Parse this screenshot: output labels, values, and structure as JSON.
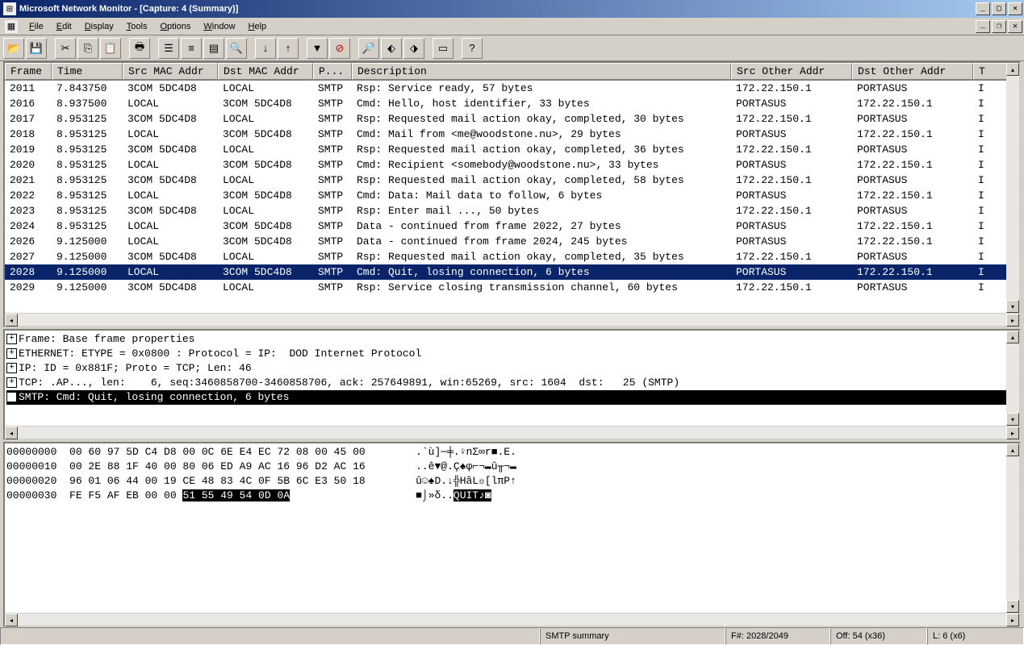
{
  "window": {
    "title": "Microsoft Network Monitor - [Capture: 4 (Summary)]"
  },
  "menu": {
    "file": "File",
    "edit": "Edit",
    "display": "Display",
    "tools": "Tools",
    "options": "Options",
    "window": "Window",
    "help": "Help"
  },
  "toolbar": {
    "open": "open",
    "save": "save",
    "cut": "cut",
    "copy": "copy",
    "paste": "paste",
    "print": "print",
    "view1": "summary",
    "view2": "detail",
    "view3": "hex",
    "zoom": "zoom",
    "down": "down",
    "up": "up",
    "filter": "filter",
    "nofilter": "nofilter",
    "find": "find",
    "prev": "prev-frame",
    "next": "next-frame",
    "pane": "pane",
    "help": "help"
  },
  "columns": {
    "frame": "Frame",
    "time": "Time",
    "srcmac": "Src MAC Addr",
    "dstmac": "Dst MAC Addr",
    "proto": "P...",
    "desc": "Description",
    "srcother": "Src Other Addr",
    "dstother": "Dst Other Addr",
    "t": "T"
  },
  "rows": [
    {
      "frame": "2011",
      "time": "7.843750",
      "srcmac": "3COM  5DC4D8",
      "dstmac": "LOCAL",
      "proto": "SMTP",
      "desc": "Rsp: Service ready, 57 bytes",
      "srcother": "172.22.150.1",
      "dstother": "PORTASUS",
      "t": "I"
    },
    {
      "frame": "2016",
      "time": "8.937500",
      "srcmac": "LOCAL",
      "dstmac": "3COM  5DC4D8",
      "proto": "SMTP",
      "desc": "Cmd: Hello, host identifier, 33 bytes",
      "srcother": "PORTASUS",
      "dstother": "172.22.150.1",
      "t": "I"
    },
    {
      "frame": "2017",
      "time": "8.953125",
      "srcmac": "3COM  5DC4D8",
      "dstmac": "LOCAL",
      "proto": "SMTP",
      "desc": "Rsp: Requested mail action okay, completed, 30 bytes",
      "srcother": "172.22.150.1",
      "dstother": "PORTASUS",
      "t": "I"
    },
    {
      "frame": "2018",
      "time": "8.953125",
      "srcmac": "LOCAL",
      "dstmac": "3COM  5DC4D8",
      "proto": "SMTP",
      "desc": "Cmd: Mail from <me@woodstone.nu>, 29 bytes",
      "srcother": "PORTASUS",
      "dstother": "172.22.150.1",
      "t": "I"
    },
    {
      "frame": "2019",
      "time": "8.953125",
      "srcmac": "3COM  5DC4D8",
      "dstmac": "LOCAL",
      "proto": "SMTP",
      "desc": "Rsp: Requested mail action okay, completed, 36 bytes",
      "srcother": "172.22.150.1",
      "dstother": "PORTASUS",
      "t": "I"
    },
    {
      "frame": "2020",
      "time": "8.953125",
      "srcmac": "LOCAL",
      "dstmac": "3COM  5DC4D8",
      "proto": "SMTP",
      "desc": "Cmd: Recipient <somebody@woodstone.nu>, 33 bytes",
      "srcother": "PORTASUS",
      "dstother": "172.22.150.1",
      "t": "I"
    },
    {
      "frame": "2021",
      "time": "8.953125",
      "srcmac": "3COM  5DC4D8",
      "dstmac": "LOCAL",
      "proto": "SMTP",
      "desc": "Rsp: Requested mail action okay, completed, 58 bytes",
      "srcother": "172.22.150.1",
      "dstother": "PORTASUS",
      "t": "I"
    },
    {
      "frame": "2022",
      "time": "8.953125",
      "srcmac": "LOCAL",
      "dstmac": "3COM  5DC4D8",
      "proto": "SMTP",
      "desc": "Cmd: Data: Mail data to follow, 6 bytes",
      "srcother": "PORTASUS",
      "dstother": "172.22.150.1",
      "t": "I"
    },
    {
      "frame": "2023",
      "time": "8.953125",
      "srcmac": "3COM  5DC4D8",
      "dstmac": "LOCAL",
      "proto": "SMTP",
      "desc": "Rsp: Enter mail ..., 50 bytes",
      "srcother": "172.22.150.1",
      "dstother": "PORTASUS",
      "t": "I"
    },
    {
      "frame": "2024",
      "time": "8.953125",
      "srcmac": "LOCAL",
      "dstmac": "3COM  5DC4D8",
      "proto": "SMTP",
      "desc": "Data - continued from frame 2022, 27 bytes",
      "srcother": "PORTASUS",
      "dstother": "172.22.150.1",
      "t": "I"
    },
    {
      "frame": "2026",
      "time": "9.125000",
      "srcmac": "LOCAL",
      "dstmac": "3COM  5DC4D8",
      "proto": "SMTP",
      "desc": "Data - continued from frame 2024, 245 bytes",
      "srcother": "PORTASUS",
      "dstother": "172.22.150.1",
      "t": "I"
    },
    {
      "frame": "2027",
      "time": "9.125000",
      "srcmac": "3COM  5DC4D8",
      "dstmac": "LOCAL",
      "proto": "SMTP",
      "desc": "Rsp: Requested mail action okay, completed, 35 bytes",
      "srcother": "172.22.150.1",
      "dstother": "PORTASUS",
      "t": "I"
    },
    {
      "frame": "2028",
      "time": "9.125000",
      "srcmac": "LOCAL",
      "dstmac": "3COM  5DC4D8",
      "proto": "SMTP",
      "desc": "Cmd: Quit, losing connection, 6 bytes",
      "srcother": "PORTASUS",
      "dstother": "172.22.150.1",
      "t": "I",
      "selected": true
    },
    {
      "frame": "2029",
      "time": "9.125000",
      "srcmac": "3COM  5DC4D8",
      "dstmac": "LOCAL",
      "proto": "SMTP",
      "desc": "Rsp: Service closing transmission channel, 60 bytes",
      "srcother": "172.22.150.1",
      "dstother": "PORTASUS",
      "t": "I"
    }
  ],
  "detail": {
    "lines": [
      {
        "text": "Frame: Base frame properties",
        "expand": true
      },
      {
        "text": "ETHERNET: ETYPE = 0x0800 : Protocol = IP:  DOD Internet Protocol",
        "expand": true
      },
      {
        "text": "IP: ID = 0x881F; Proto = TCP; Len: 46",
        "expand": true
      },
      {
        "text": "TCP: .AP..., len:    6, seq:3460858700-3460858706, ack: 257649891, win:65269, src: 1604  dst:   25 (SMTP)",
        "expand": true
      },
      {
        "text": "SMTP: Cmd: Quit, losing connection, 6 bytes",
        "expand": true,
        "hl": true
      }
    ]
  },
  "hex": {
    "lines": [
      {
        "off": "00000000",
        "bytes": "00 60 97 5D C4 D8 00 0C 6E E4 EC 72 08 00 45 00",
        "ascii": ".`ù]─╪.♀nΣ∞r■.E."
      },
      {
        "off": "00000010",
        "bytes": "00 2E 88 1F 40 00 80 06 ED A9 AC 16 96 D2 AC 16",
        "ascii": "..ê▼@.Ç♠φ⌐¬▬û╥¬▬"
      },
      {
        "off": "00000020",
        "bytes": "96 01 06 44 00 19 CE 48 83 4C 0F 5B 6C E3 50 18",
        "ascii": "û☺♠D.↓╬HâL☼[lπP↑"
      },
      {
        "off": "00000030",
        "bytes_pre": "FE F5 AF EB 00 00 ",
        "bytes_hi": "51 55 49 54 0D 0A",
        "ascii_pre": "■⌡»δ..",
        "ascii_hi": "QUIT♪◙"
      }
    ]
  },
  "status": {
    "desc": "SMTP summary",
    "frame": "F#: 2028/2049",
    "off": "Off: 54 (x36)",
    "len": "L: 6 (x6)"
  }
}
